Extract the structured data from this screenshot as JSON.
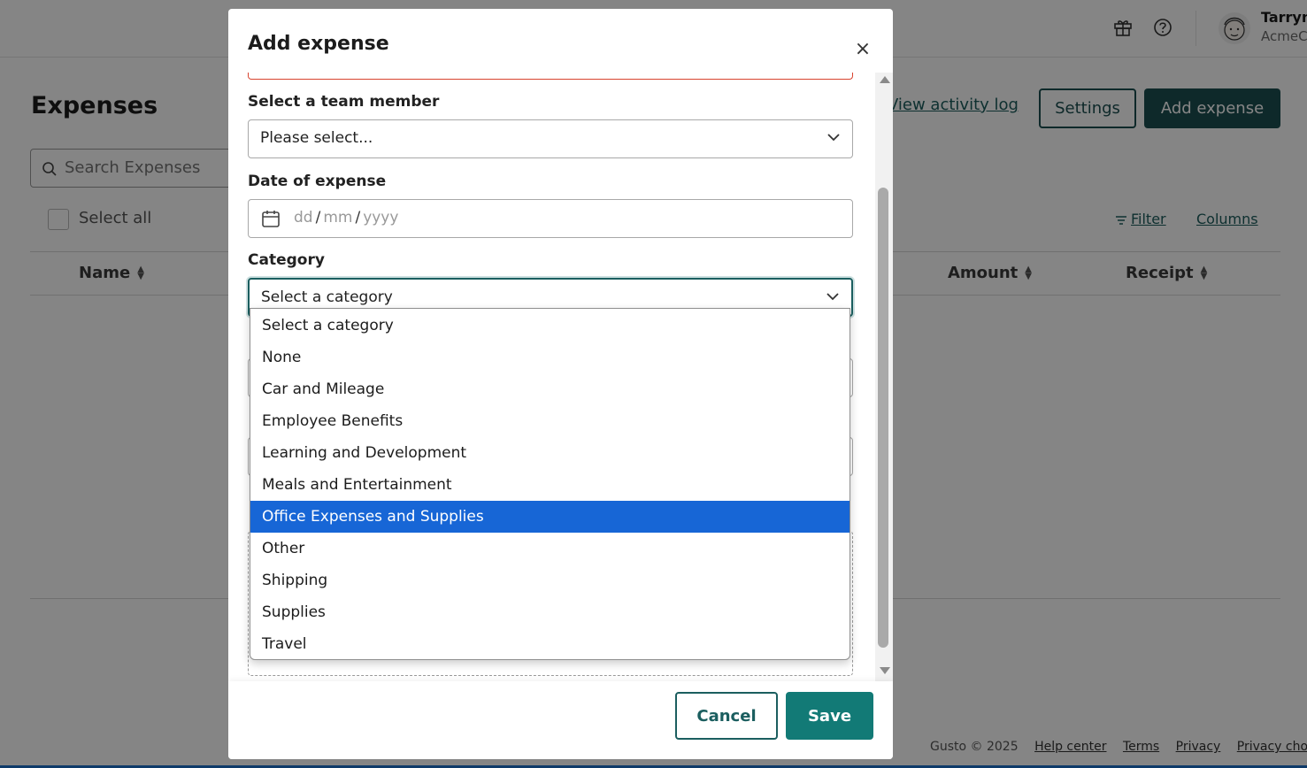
{
  "topbar": {
    "user_name": "Tarryn",
    "company": "AcmeC"
  },
  "page": {
    "title": "Expenses",
    "activity_link": "View activity log",
    "settings_label": "Settings",
    "add_expense_label": "Add expense",
    "search_placeholder": "Search Expenses",
    "select_all_label": "Select all",
    "filter_label": "Filter",
    "columns_label": "Columns",
    "table_columns": [
      "Name",
      "Amount",
      "Receipt"
    ]
  },
  "footer": {
    "copyright": "Gusto © 2025",
    "links": [
      "Help center",
      "Terms",
      "Privacy",
      "Privacy choices"
    ]
  },
  "modal": {
    "title": "Add expense",
    "close_symbol": "×",
    "team_member": {
      "label": "Select a team member",
      "value": "Please select..."
    },
    "date": {
      "label": "Date of expense",
      "day_placeholder": "dd",
      "month_placeholder": "mm",
      "year_placeholder": "yyyy",
      "separator": "/"
    },
    "category": {
      "label": "Category",
      "value": "Select a category",
      "options": [
        "Select a category",
        "None",
        "Car and Mileage",
        "Employee Benefits",
        "Learning and Development",
        "Meals and Entertainment",
        "Office Expenses and Supplies",
        "Other",
        "Shipping",
        "Supplies",
        "Travel"
      ],
      "highlighted": "Office Expenses and Supplies"
    },
    "cancel_label": "Cancel",
    "save_label": "Save"
  },
  "colors": {
    "brand_dark": "#1c4f51",
    "save_button": "#127a76",
    "dropdown_highlight": "#1766d6",
    "error_border": "#d8432e"
  }
}
